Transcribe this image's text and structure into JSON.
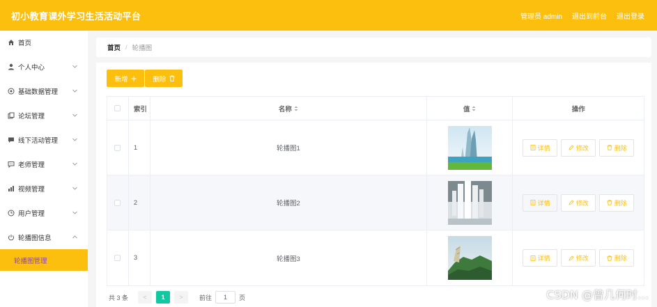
{
  "colors": {
    "accent": "#fdbf0d",
    "pager_active": "#13c7a0"
  },
  "header": {
    "title": "初小教育课外学习生活活动平台",
    "admin_label": "管理员 admin",
    "front_label": "退出到前台",
    "logout_label": "退出登录"
  },
  "sidebar": {
    "items": [
      {
        "label": "首页",
        "icon": "home-icon"
      },
      {
        "label": "个人中心",
        "icon": "user-icon"
      },
      {
        "label": "基础数据管理",
        "icon": "settings-icon"
      },
      {
        "label": "论坛管理",
        "icon": "copy-icon"
      },
      {
        "label": "线下活动管理",
        "icon": "chat-icon"
      },
      {
        "label": "老师管理",
        "icon": "message-icon"
      },
      {
        "label": "视频管理",
        "icon": "chart-icon"
      },
      {
        "label": "用户管理",
        "icon": "clock-icon"
      },
      {
        "label": "轮播图信息",
        "icon": "power-icon"
      }
    ],
    "sub_item": "轮播图管理"
  },
  "breadcrumb": {
    "home": "首页",
    "separator": "/",
    "current": "轮播图"
  },
  "toolbar": {
    "add_label": "新增",
    "delete_label": "删除"
  },
  "table": {
    "headers": {
      "index": "索引",
      "name": "名称",
      "value": "值",
      "ops": "操作"
    },
    "rows": [
      {
        "index": "1",
        "name": "轮播图1",
        "image": "skyscraper-landscape"
      },
      {
        "index": "2",
        "name": "轮播图2",
        "image": "white-towers"
      },
      {
        "index": "3",
        "name": "轮播图3",
        "image": "floating-island"
      }
    ],
    "op_labels": {
      "detail": "详情",
      "edit": "修改",
      "delete": "删除"
    }
  },
  "pager": {
    "total": "共 3 条",
    "prev": "<",
    "current": "1",
    "next": ">",
    "goto_label": "前往",
    "goto_value": "1",
    "page_suffix": "页"
  },
  "watermark": "CSDN @曾几何时…"
}
